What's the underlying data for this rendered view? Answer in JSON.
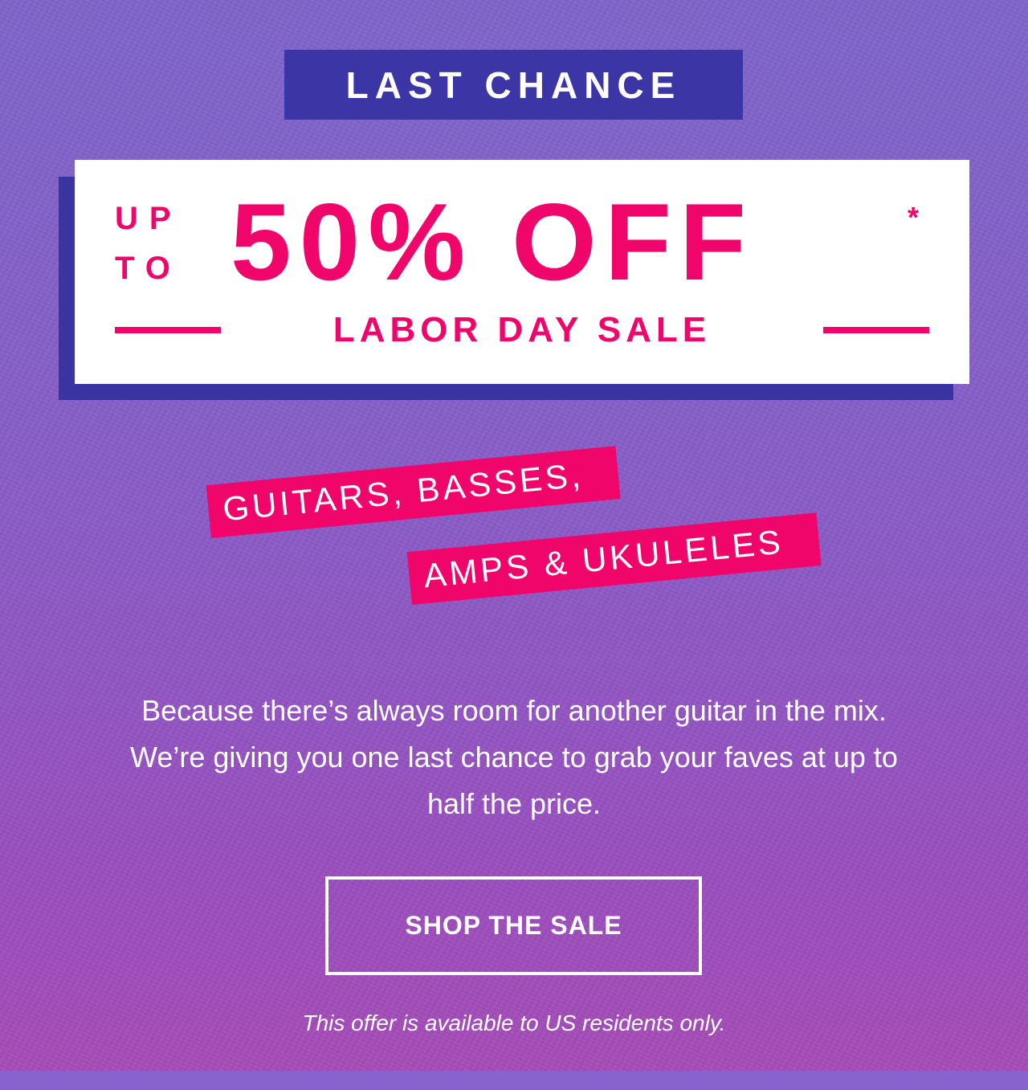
{
  "banner": {
    "tag": "LAST CHANCE",
    "offer_prefix_top": "UP",
    "offer_prefix_bottom": "TO",
    "offer_main": "50% OFF",
    "offer_asterisk": "*",
    "event_label": "LABOR DAY SALE"
  },
  "categories": {
    "line_1": "GUITARS, BASSES,",
    "line_2": "AMPS & UKULELES"
  },
  "body": {
    "copy": "Because there’s always room for another guitar in the mix. We’re giving you one last chance to grab your faves at up to half the price."
  },
  "cta": {
    "label": "SHOP THE SALE"
  },
  "disclaimer": {
    "text": "This offer is available to US residents only."
  },
  "colors": {
    "accent": "#f0066b",
    "navy": "#3b35a6",
    "background_top": "#7f66cc",
    "background_bottom": "#a94cb8"
  }
}
